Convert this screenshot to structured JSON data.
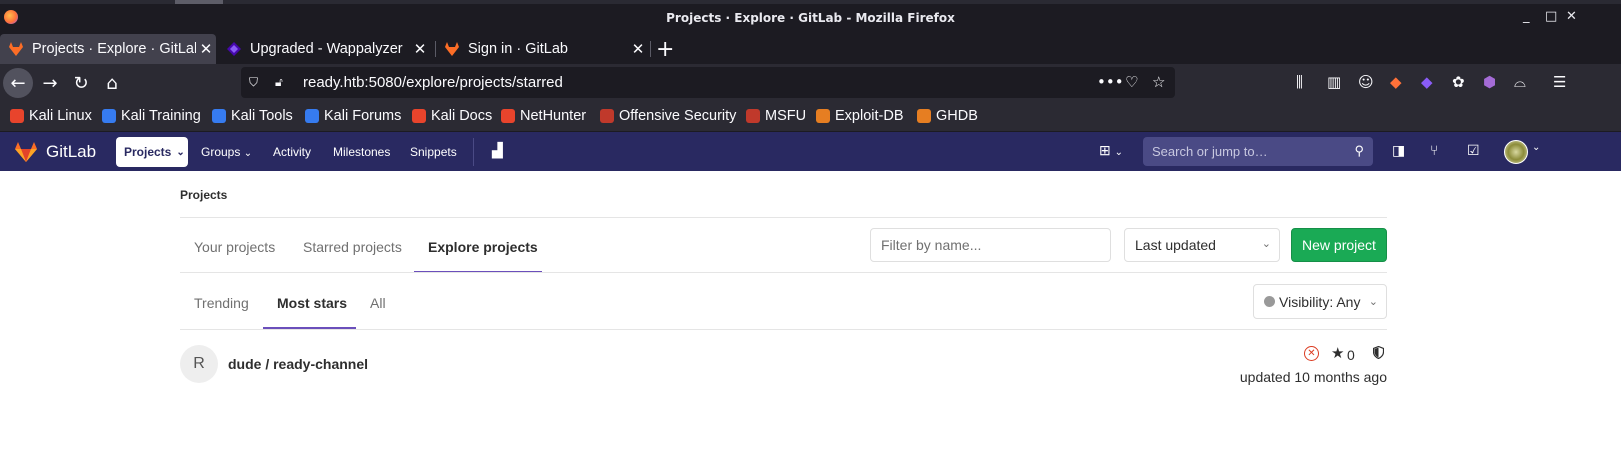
{
  "window": {
    "title": "Projects · Explore · GitLab - Mozilla Firefox"
  },
  "tabs": [
    {
      "label": "Projects · Explore · GitLab",
      "active": true
    },
    {
      "label": "Upgraded - Wappalyzer",
      "active": false
    },
    {
      "label": "Sign in · GitLab",
      "active": false
    }
  ],
  "address_bar": {
    "url": "ready.htb:5080/explore/projects/starred"
  },
  "bookmarks": [
    {
      "label": "Kali Linux",
      "color": "#e8442c"
    },
    {
      "label": "Kali Training",
      "color": "#367bf0"
    },
    {
      "label": "Kali Tools",
      "color": "#367bf0"
    },
    {
      "label": "Kali Forums",
      "color": "#367bf0"
    },
    {
      "label": "Kali Docs",
      "color": "#e8442c"
    },
    {
      "label": "NetHunter",
      "color": "#e8442c"
    },
    {
      "label": "Offensive Security",
      "color": "#c0392b"
    },
    {
      "label": "MSFU",
      "color": "#c0392b"
    },
    {
      "label": "Exploit-DB",
      "color": "#e67e22"
    },
    {
      "label": "GHDB",
      "color": "#e67e22"
    }
  ],
  "gitlab_nav": {
    "brand": "GitLab",
    "projects_label": "Projects",
    "links": [
      "Groups",
      "Activity",
      "Milestones",
      "Snippets"
    ],
    "search_placeholder": "Search or jump to…"
  },
  "page": {
    "breadcrumb": "Projects",
    "main_tabs": [
      "Your projects",
      "Starred projects",
      "Explore projects"
    ],
    "active_main_tab": "Explore projects",
    "filter_placeholder": "Filter by name...",
    "sort_value": "Last updated",
    "new_project_label": "New project",
    "sub_tabs": [
      "Trending",
      "Most stars",
      "All"
    ],
    "active_sub_tab": "Most stars",
    "visibility_label": "Visibility: Any"
  },
  "projects": [
    {
      "avatar_letter": "R",
      "name": "dude / ready-channel",
      "stars": "0",
      "updated": "updated 10 months ago",
      "pipeline_status": "failed"
    }
  ],
  "colors": {
    "gitlab_nav": "#292961",
    "accent": "#6b4fbb",
    "primary_button": "#1aaa55",
    "failed": "#db3b21"
  }
}
